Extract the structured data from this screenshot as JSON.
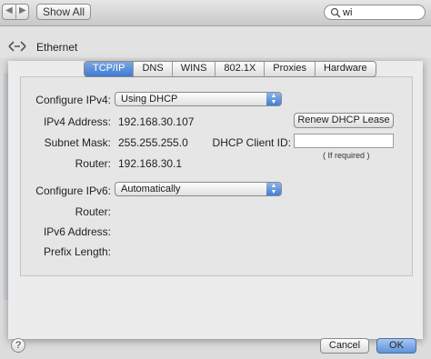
{
  "toolbar": {
    "back_label": "◀",
    "forward_label": "▶",
    "show_all_label": "Show All",
    "search_value": "wi"
  },
  "header": {
    "service_name": "Ethernet"
  },
  "tabs": [
    {
      "label": "TCP/IP",
      "active": true
    },
    {
      "label": "DNS"
    },
    {
      "label": "WINS"
    },
    {
      "label": "802.1X"
    },
    {
      "label": "Proxies"
    },
    {
      "label": "Hardware"
    }
  ],
  "ipv4": {
    "configure_label": "Configure IPv4:",
    "configure_value": "Using DHCP",
    "address_label": "IPv4 Address:",
    "address_value": "192.168.30.107",
    "subnet_label": "Subnet Mask:",
    "subnet_value": "255.255.255.0",
    "router_label": "Router:",
    "router_value": "192.168.30.1",
    "renew_button": "Renew DHCP Lease",
    "client_id_label": "DHCP Client ID:",
    "client_id_value": "",
    "client_id_hint": "( If required )"
  },
  "ipv6": {
    "configure_label": "Configure IPv6:",
    "configure_value": "Automatically",
    "router_label": "Router:",
    "address_label": "IPv6 Address:",
    "prefix_label": "Prefix Length:"
  },
  "footer": {
    "help_label": "?",
    "cancel_label": "Cancel",
    "ok_label": "OK"
  }
}
